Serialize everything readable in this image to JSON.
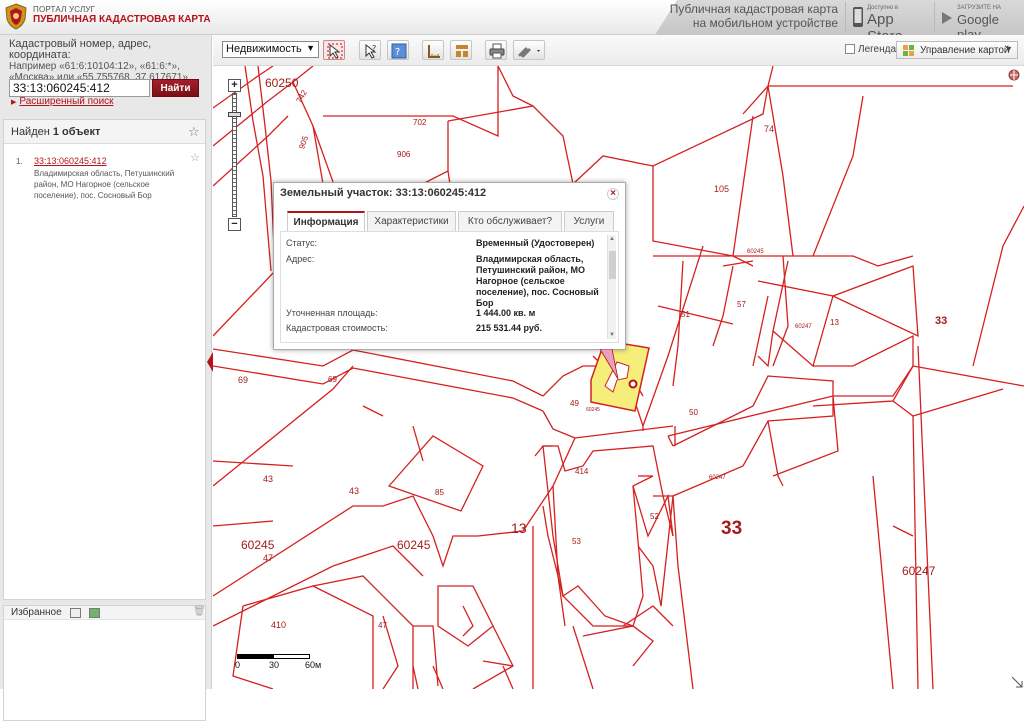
{
  "header": {
    "portal_small": "ПОРТАЛ УСЛУГ",
    "portal_big": "ПУБЛИЧНАЯ КАДАСТРОВАЯ КАРТА",
    "promo_line1": "Публичная кадастровая карта",
    "promo_line2": "на мобильном устройстве",
    "appstore_small": "Доступно в",
    "appstore_big": "App Store",
    "googleplay_small": "ЗАГРУЗИТЕ НА",
    "googleplay_big": "Google play"
  },
  "sidebar": {
    "hint_lead": "Кадастровый номер, адрес, координата:",
    "hint_example": "Например «61:6:10104:12», «61:6:*», «Москва» или «55.755768, 37.617671»",
    "search_value": "33:13:060245:412",
    "find_label": "Найти",
    "advanced_search": "Расширенный поиск",
    "results_prefix": "Найден ",
    "results_count": "1 объект",
    "results": [
      {
        "num": "1.",
        "link": "33:13:060245:412",
        "address": "Владимирская область, Петушинский район, МО Нагорное (сельское поселение), пос. Сосновый Бор"
      }
    ],
    "favorites_title": "Избранное"
  },
  "toolbar": {
    "realty_select": "Недвижимость",
    "legend_label": "Легенда",
    "map_management": "Управление картой",
    "tool_icons": [
      "select-arrow-icon",
      "identify-icon",
      "info-icon",
      "measure-icon",
      "layers-icon",
      "print-icon",
      "link-icon"
    ]
  },
  "map": {
    "labels": {
      "l60250": "60250",
      "l742": "742",
      "l905": "905",
      "l906": "906",
      "l702": "702",
      "l74": "74",
      "l105": "105",
      "l60245a": "60245",
      "l51": "51",
      "l57": "57",
      "l60247a": "60247",
      "l13a": "13",
      "l33a": "33",
      "l69a": "69",
      "l69b": "69",
      "l49": "49",
      "l60245b": "60245",
      "l50": "50",
      "l414": "414",
      "l60247b": "60247",
      "l43a": "43",
      "l43b": "43",
      "l85": "85",
      "l13b": "13",
      "l33b": "33",
      "l52": "52",
      "l53": "53",
      "l60245c": "60245",
      "l47a": "47",
      "l60245d": "60245",
      "l60247c": "60247",
      "l410": "410",
      "l47b": "47"
    },
    "scale": {
      "s0": "0",
      "s30": "30",
      "s60": "60м"
    }
  },
  "popup": {
    "title": "Земельный участок: 33:13:060245:412",
    "tabs": [
      "Информация",
      "Характеристики",
      "Кто обслуживает?",
      "Услуги"
    ],
    "rows": [
      {
        "label": "Статус:",
        "value": "Временный (Удостоверен)"
      },
      {
        "label": "Адрес:",
        "value": "Владимирская область, Петушинский район, МО Нагорное (сельское поселение), пос. Сосновый Бор"
      },
      {
        "label": "Уточненная площадь:",
        "value": "1 444.00 кв. м"
      },
      {
        "label": "Кадастровая стоимость:",
        "value": "215 531.44 руб."
      }
    ]
  },
  "colors": {
    "brand_red": "#b4121c",
    "parcel_line": "#d62020",
    "selected_fill": "#f5ee7a"
  }
}
